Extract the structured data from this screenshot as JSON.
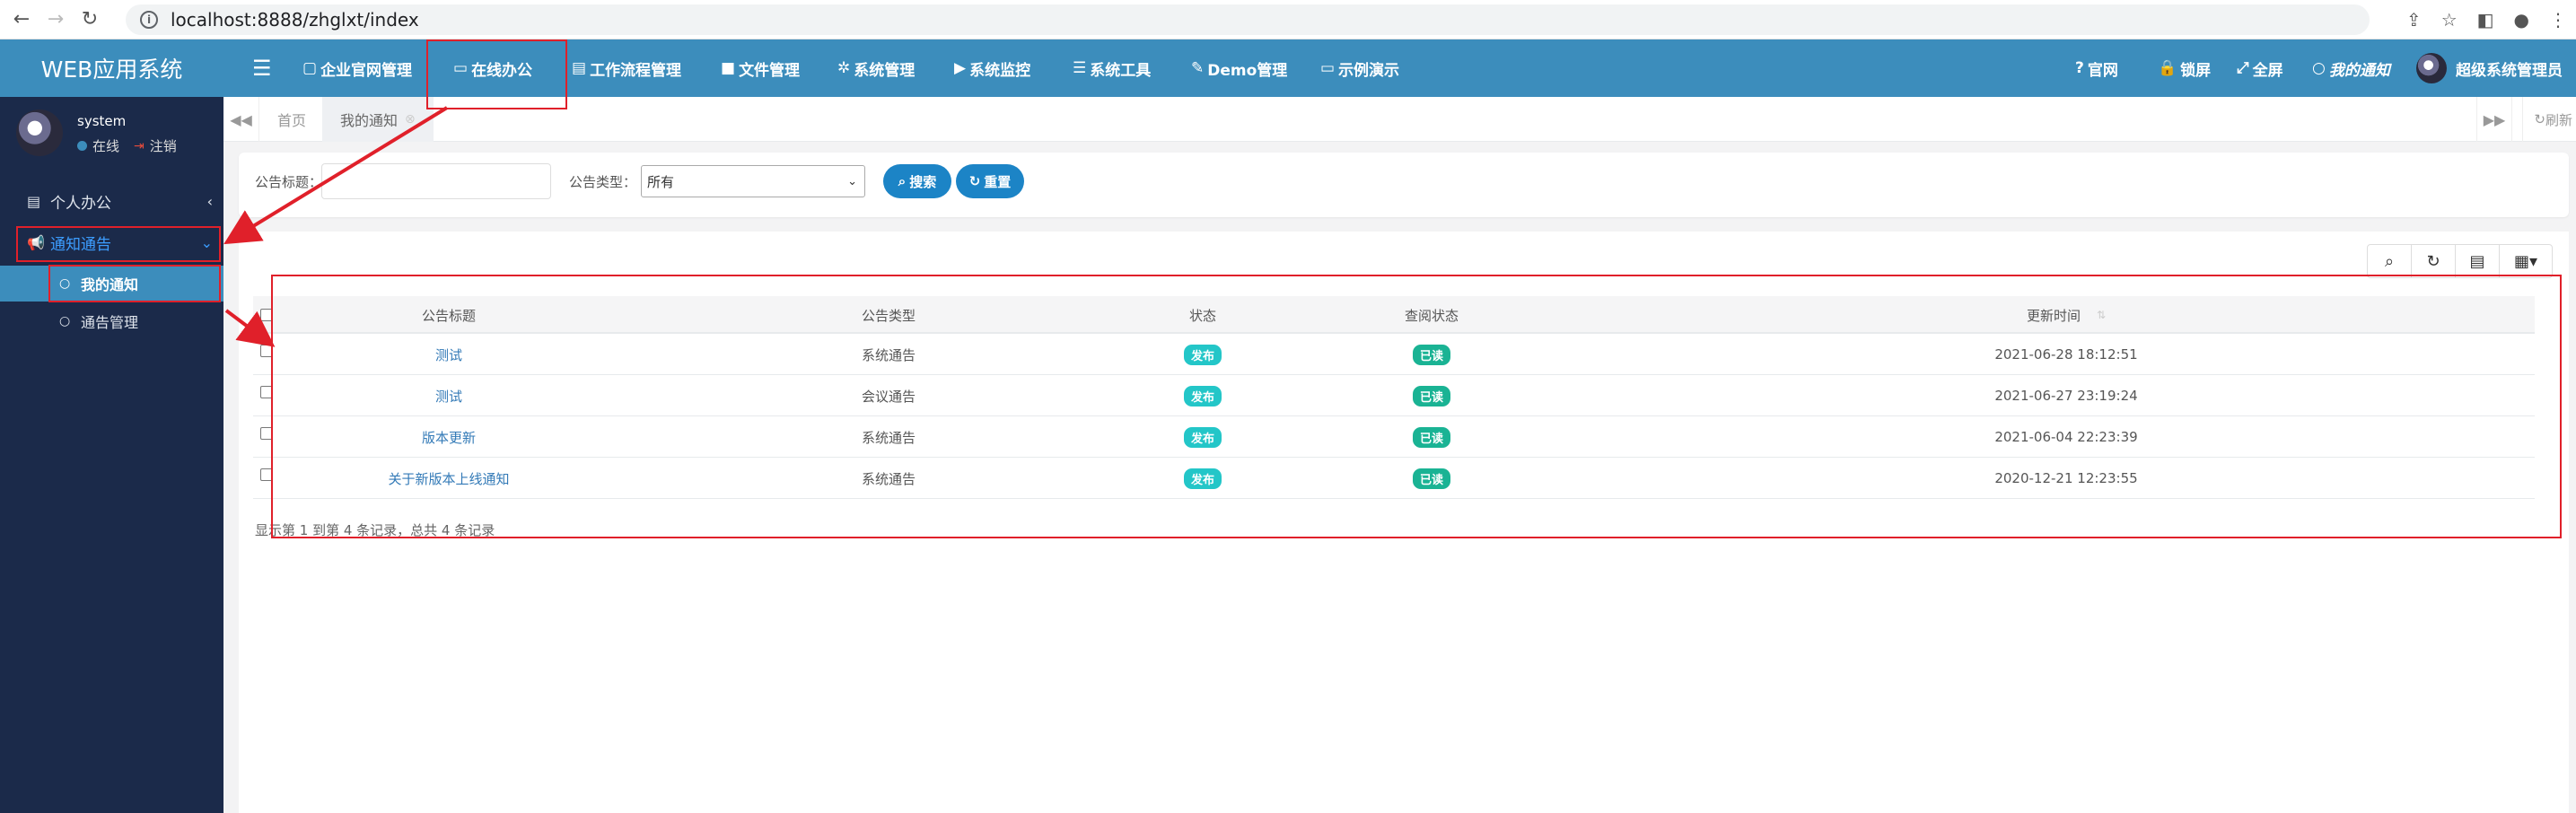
{
  "browser": {
    "url": "localhost:8888/zhglxt/index",
    "back": "←",
    "forward": "→",
    "reload": "↻"
  },
  "app": {
    "brand": "WEB应用系统"
  },
  "user": {
    "name": "system",
    "status": "在线",
    "logout": "注销"
  },
  "sidebar": {
    "items": [
      {
        "label": "个人办公",
        "icon": "id-card-icon",
        "caret": "‹"
      },
      {
        "label": "通知通告",
        "icon": "bullhorn-icon",
        "caret": "⌄"
      }
    ],
    "subitems": [
      {
        "label": "我的通知",
        "icon": "comment-icon"
      },
      {
        "label": "通告管理",
        "icon": "comment-icon"
      }
    ]
  },
  "topnav": {
    "links": [
      {
        "label": "企业官网管理",
        "icon": "▢"
      },
      {
        "label": "在线办公",
        "icon": "▭"
      },
      {
        "label": "工作流程管理",
        "icon": "▤"
      },
      {
        "label": "文件管理",
        "icon": "■"
      },
      {
        "label": "系统管理",
        "icon": "✲"
      },
      {
        "label": "系统监控",
        "icon": "▶"
      },
      {
        "label": "系统工具",
        "icon": "☰"
      },
      {
        "label": "Demo管理",
        "icon": "✎"
      },
      {
        "label": "示例演示",
        "icon": "▭"
      }
    ],
    "right": {
      "official": "官网",
      "lock": "锁屏",
      "fullscreen": "全屏",
      "notice": "我的通知",
      "admin": "超级系统管理员"
    }
  },
  "tabs": {
    "home": "首页",
    "current": "我的通知",
    "refresh": "刷新"
  },
  "search": {
    "title_label": "公告标题：",
    "type_label": "公告类型：",
    "type_value": "所有",
    "search_btn": "搜索",
    "reset_btn": "重置"
  },
  "table": {
    "headers": [
      "公告标题",
      "公告类型",
      "状态",
      "查阅状态",
      "更新时间"
    ],
    "rows": [
      {
        "title": "测试",
        "type": "系统通告",
        "status": "发布",
        "read": "已读",
        "time": "2021-06-28 18:12:51"
      },
      {
        "title": "测试",
        "type": "会议通告",
        "status": "发布",
        "read": "已读",
        "time": "2021-06-27 23:19:24"
      },
      {
        "title": "版本更新",
        "type": "系统通告",
        "status": "发布",
        "read": "已读",
        "time": "2021-06-04 22:23:39"
      },
      {
        "title": "关于新版本上线通知",
        "type": "系统通告",
        "status": "发布",
        "read": "已读",
        "time": "2020-12-21 12:23:55"
      }
    ],
    "summary": "显示第 1 到第 4 条记录，总共 4 条记录"
  },
  "colors": {
    "header": "#3c8dbc",
    "sidebar": "#1b2a4a",
    "annotation": "#e0202a"
  }
}
